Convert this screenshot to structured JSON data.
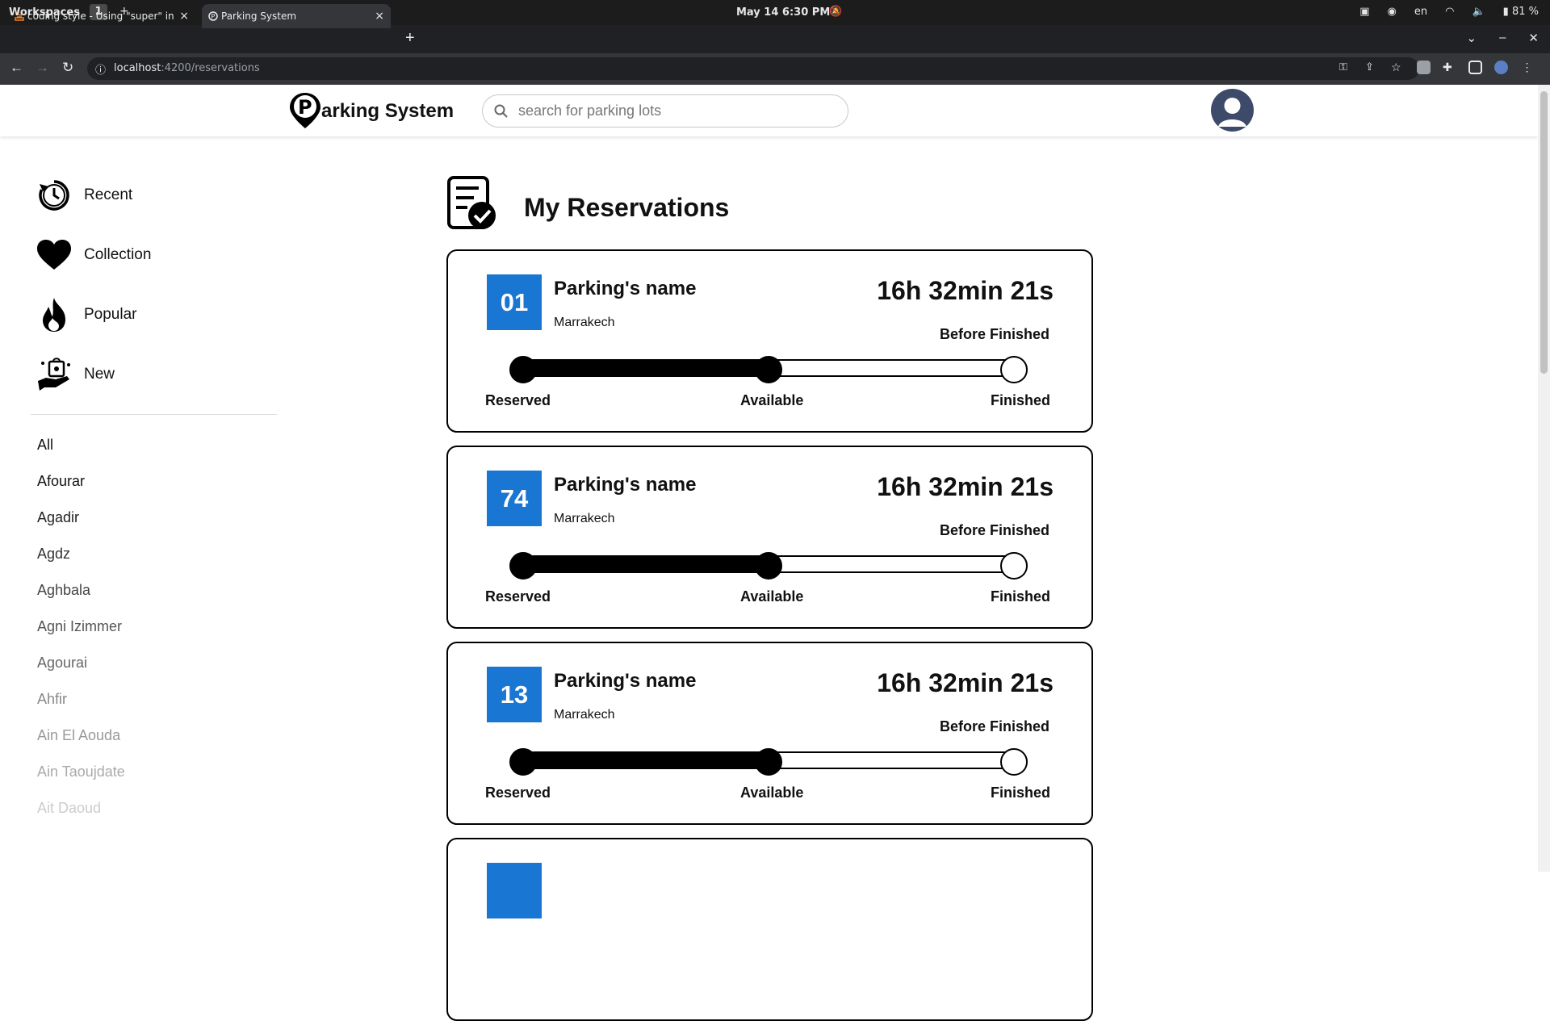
{
  "system_bar": {
    "workspaces": "Workspaces",
    "workspace_num": "1",
    "workspace_add": "+",
    "clock": "May 14  6:30 PM",
    "lang": "en",
    "battery": "81 %"
  },
  "browser": {
    "tabs": [
      {
        "title": "coding style - Using \"super\" in",
        "close": "×"
      },
      {
        "title": "Parking System",
        "close": "×"
      }
    ],
    "new_tab": "+",
    "url_host": "localhost",
    "url_path": ":4200/reservations"
  },
  "header": {
    "logo_text": "arking System",
    "search_placeholder": "search for parking lots"
  },
  "sidebar": {
    "items": [
      {
        "label": "Recent",
        "icon": "recent-clock-icon"
      },
      {
        "label": "Collection",
        "icon": "heart-icon"
      },
      {
        "label": "Popular",
        "icon": "flame-icon"
      },
      {
        "label": "New",
        "icon": "new-bag-hand-icon"
      }
    ],
    "cities": [
      "All",
      "Afourar",
      "Agadir",
      "Agdz",
      "Aghbala",
      "Agni Izimmer",
      "Agourai",
      "Ahfir",
      "Ain El Aouda",
      "Ain Taoujdate",
      "Ait Daoud"
    ]
  },
  "main": {
    "title": "My Reservations",
    "reservations": [
      {
        "number": "01",
        "name": "Parking's name",
        "city": "Marrakech",
        "timer": "16h 32min 21s",
        "timer_label": "Before Finished",
        "progress": 0.5
      },
      {
        "number": "74",
        "name": "Parking's name",
        "city": "Marrakech",
        "timer": "16h 32min 21s",
        "timer_label": "Before Finished",
        "progress": 0.5
      },
      {
        "number": "13",
        "name": "Parking's name",
        "city": "Marrakech",
        "timer": "16h 32min 21s",
        "timer_label": "Before Finished",
        "progress": 0.5
      }
    ],
    "steps": [
      "Reserved",
      "Available",
      "Finished"
    ]
  },
  "colors": {
    "badge": "#1976d2",
    "text": "#111111"
  }
}
